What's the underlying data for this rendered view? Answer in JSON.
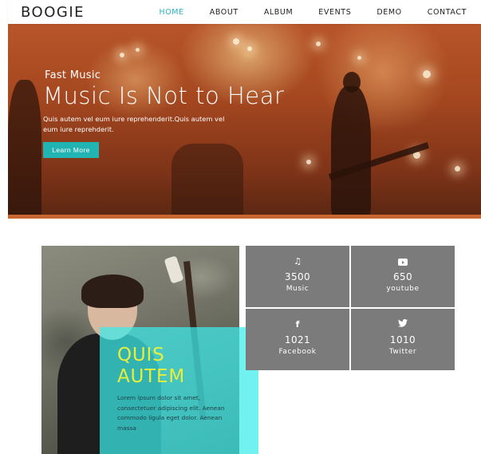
{
  "nav": {
    "logo": "BOOGIE",
    "items": [
      {
        "label": "HOME",
        "active": true
      },
      {
        "label": "ABOUT"
      },
      {
        "label": "ALBUM"
      },
      {
        "label": "EVENTS"
      },
      {
        "label": "DEMO"
      },
      {
        "label": "CONTACT"
      }
    ]
  },
  "hero": {
    "subtitle": "Fast Music",
    "title": "Music Is Not to Hear",
    "text": "Quis autem vel eum iure reprehenderit.Quis autem vel eum iure reprehderit.",
    "button": "Learn More"
  },
  "feature": {
    "title_line1": "QUIS",
    "title_line2": "AUTEM",
    "text": "Lorem ipsum dolor sit amet, consectetuer adipiscing elit. Aenean commodo ligula eget dolor. Aenean massa"
  },
  "stats": [
    {
      "icon": "music-note-icon",
      "value": "3500",
      "label": "Music"
    },
    {
      "icon": "youtube-icon",
      "value": "650",
      "label": "youtube"
    },
    {
      "icon": "facebook-icon",
      "value": "1021",
      "label": "Facebook"
    },
    {
      "icon": "twitter-icon",
      "value": "1010",
      "label": "Twitter"
    }
  ],
  "colors": {
    "accent": "#2bb5c4",
    "button": "#22b3b3",
    "stat_tile": "#7b7b7b",
    "overlay_title": "#e8ef3a",
    "overlay": "#3cebeb"
  }
}
